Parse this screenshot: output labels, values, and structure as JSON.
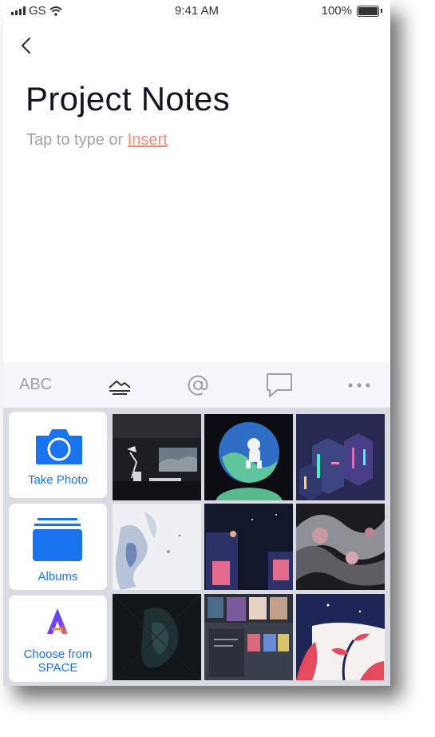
{
  "status_bar": {
    "carrier": "GS",
    "time": "9:41 AM",
    "battery": "100%"
  },
  "note": {
    "title": "Project Notes",
    "hint_prefix": "Tap to type or",
    "hint_link": "Insert"
  },
  "toolbar": {
    "abc_label": "ABC"
  },
  "picker": {
    "take_photo": "Take Photo",
    "albums": "Albums",
    "choose_space": "Choose from SPACE"
  },
  "colors": {
    "accent": "#1a73f0",
    "link": "#f08b7a",
    "toolbar_icon": "#9aa0ad",
    "picker_bg": "#d9dbe3"
  }
}
